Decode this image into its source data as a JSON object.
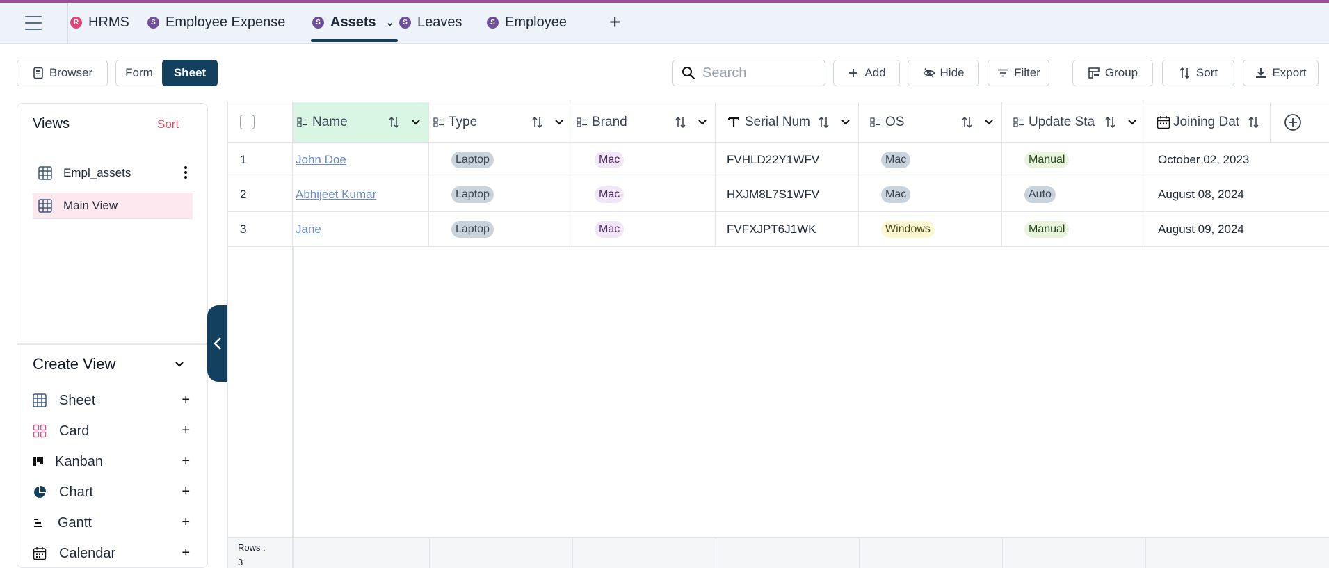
{
  "tabs": [
    {
      "badge": "R",
      "label": "HRMS"
    },
    {
      "badge": "S",
      "label": "Employee Expense"
    },
    {
      "badge": "S",
      "label": "Assets",
      "active": true
    },
    {
      "badge": "S",
      "label": "Leaves"
    },
    {
      "badge": "S",
      "label": "Employee"
    }
  ],
  "toolbar": {
    "browser": "Browser",
    "form": "Form",
    "sheet": "Sheet",
    "search_placeholder": "Search",
    "add": "Add",
    "hide": "Hide",
    "filter": "Filter",
    "group": "Group",
    "sort": "Sort",
    "export": "Export"
  },
  "sidebar": {
    "views_title": "Views",
    "views_sort": "Sort",
    "views": [
      {
        "label": "Empl_assets"
      },
      {
        "label": "Main View",
        "selected": true
      }
    ],
    "create_view_title": "Create View",
    "create_items": [
      {
        "label": "Sheet",
        "icon": "sheet-icon"
      },
      {
        "label": "Card",
        "icon": "card-icon"
      },
      {
        "label": "Kanban",
        "icon": "kanban-icon"
      },
      {
        "label": "Chart",
        "icon": "chart-icon"
      },
      {
        "label": "Gantt",
        "icon": "gantt-icon"
      },
      {
        "label": "Calendar",
        "icon": "calendar-icon"
      }
    ]
  },
  "grid": {
    "columns": [
      {
        "label": "Name",
        "icon": "field-icon"
      },
      {
        "label": "Type",
        "icon": "field-icon"
      },
      {
        "label": "Brand",
        "icon": "field-icon"
      },
      {
        "label": "Serial Num",
        "icon": "text-icon"
      },
      {
        "label": "OS",
        "icon": "field-icon"
      },
      {
        "label": "Update Sta",
        "icon": "field-icon"
      },
      {
        "label": "Joining Dat",
        "icon": "calendar-icon"
      }
    ],
    "rows": [
      {
        "n": "1",
        "name": "John Doe",
        "type": "Laptop",
        "brand": "Mac",
        "serial": "FVHLD22Y1WFV",
        "os": "Mac",
        "update": "Manual",
        "joining": "October 02, 2023"
      },
      {
        "n": "2",
        "name": "Abhijeet Kumar",
        "type": "Laptop",
        "brand": "Mac",
        "serial": "HXJM8L7S1WFV",
        "os": "Mac",
        "update": "Auto",
        "joining": "August 08, 2024"
      },
      {
        "n": "3",
        "name": "Jane",
        "type": "Laptop",
        "brand": "Mac",
        "serial": "FVFXJPT6J1WK",
        "os": "Windows",
        "update": "Manual",
        "joining": "August 09, 2024"
      }
    ],
    "rows_label": "Rows :",
    "rows_count": "3"
  },
  "colors": {
    "accent": "#13405f",
    "top_stripe": "#9b4f96",
    "sort_text": "#d64d62"
  }
}
